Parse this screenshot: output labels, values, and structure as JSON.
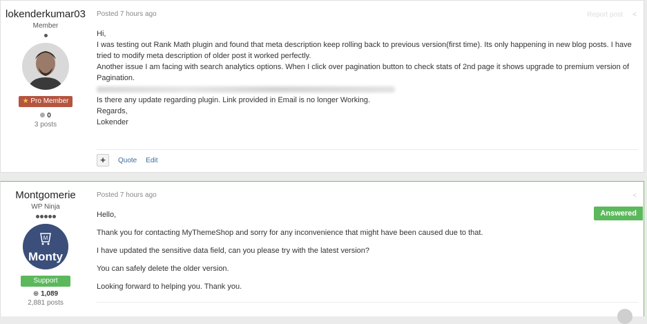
{
  "post1": {
    "author": "lokenderkumar03",
    "rank": "Member",
    "badge": "Pro Member",
    "reputation": "0",
    "posts": "3 posts",
    "posted": "Posted 7 hours ago",
    "report": "Report post",
    "lines": [
      "Hi,",
      "I was testing out Rank Math plugin and found that meta description keep rolling back to previous version(first time). Its only happening in new blog posts. I have tried to modify meta description of older post it worked perfectly.",
      "Another issue I am facing with search analytics options. When I click over pagination button to check stats of 2nd page it shows upgrade to premium version of Pagination.",
      "Is there any update regarding plugin. Link provided in Email is no longer Working.",
      "Regards,",
      "Lokender"
    ],
    "actions": {
      "quote": "Quote",
      "edit": "Edit"
    }
  },
  "post2": {
    "author": "Montgomerie",
    "rank": "WP Ninja",
    "avatar_text": "Monty",
    "badge": "Support",
    "reputation": "1,089",
    "posts": "2,881 posts",
    "posted": "Posted 7 hours ago",
    "status": "Answered",
    "lines": [
      "Hello,",
      "Thank you for contacting MyThemeShop and sorry for any inconvenience that might have been caused due to that.",
      "I have updated the sensitive data field, can you please try with the latest version?",
      "You can safely delete the older version.",
      "Looking forward to helping you. Thank you."
    ]
  },
  "colors": {
    "pro_badge": "#b5543f",
    "support_badge": "#5cb85c",
    "answered": "#5cb85c",
    "link": "#3a6a9a",
    "avatar2_bg": "#3b4f7a"
  }
}
